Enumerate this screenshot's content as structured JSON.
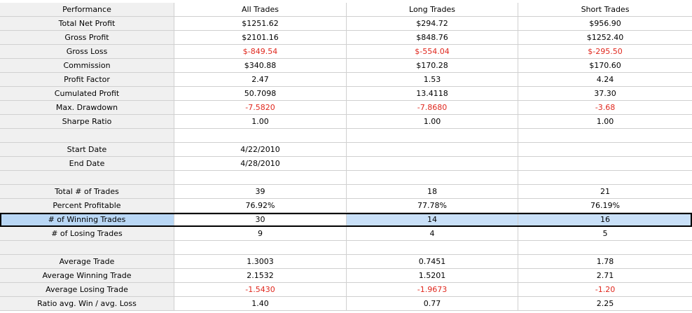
{
  "header": {
    "metric": "Performance",
    "all": "All Trades",
    "long": "Long Trades",
    "short": "Short Trades"
  },
  "rows": [
    {
      "label": "Total Net Profit",
      "all": "$1251.62",
      "long": "$294.72",
      "short": "$956.90"
    },
    {
      "label": "Gross Profit",
      "all": "$2101.16",
      "long": "$848.76",
      "short": "$1252.40"
    },
    {
      "label": "Gross Loss",
      "all": "$-849.54",
      "long": "$-554.04",
      "short": "$-295.50"
    },
    {
      "label": "Commission",
      "all": "$340.88",
      "long": "$170.28",
      "short": "$170.60"
    },
    {
      "label": "Profit Factor",
      "all": "2.47",
      "long": "1.53",
      "short": "4.24"
    },
    {
      "label": "Cumulated Profit",
      "all": "50.7098",
      "long": "13.4118",
      "short": "37.30"
    },
    {
      "label": "Max. Drawdown",
      "all": "-7.5820",
      "long": "-7.8680",
      "short": "-3.68"
    },
    {
      "label": "Sharpe Ratio",
      "all": "1.00",
      "long": "1.00",
      "short": "1.00"
    },
    {
      "label": "",
      "all": "",
      "long": "",
      "short": ""
    },
    {
      "label": "Start Date",
      "all": "4/22/2010",
      "long": "",
      "short": ""
    },
    {
      "label": "End Date",
      "all": "4/28/2010",
      "long": "",
      "short": ""
    },
    {
      "label": "",
      "all": "",
      "long": "",
      "short": ""
    },
    {
      "label": "Total # of Trades",
      "all": "39",
      "long": "18",
      "short": "21"
    },
    {
      "label": "Percent Profitable",
      "all": "76.92%",
      "long": "77.78%",
      "short": "76.19%"
    },
    {
      "label": "# of Winning Trades",
      "all": "30",
      "long": "14",
      "short": "16"
    },
    {
      "label": "# of Losing Trades",
      "all": "9",
      "long": "4",
      "short": "5"
    },
    {
      "label": "",
      "all": "",
      "long": "",
      "short": ""
    },
    {
      "label": "Average Trade",
      "all": "1.3003",
      "long": "0.7451",
      "short": "1.78"
    },
    {
      "label": "Average Winning Trade",
      "all": "2.1532",
      "long": "1.5201",
      "short": "2.71"
    },
    {
      "label": "Average Losing Trade",
      "all": "-1.5430",
      "long": "-1.9673",
      "short": "-1.20"
    },
    {
      "label": "Ratio avg. Win / avg. Loss",
      "all": "1.40",
      "long": "0.77",
      "short": "2.25"
    }
  ],
  "colors": {
    "negative": "#e0281e",
    "selection": "#c9e0f8",
    "row_header": "#f0f0f0"
  }
}
